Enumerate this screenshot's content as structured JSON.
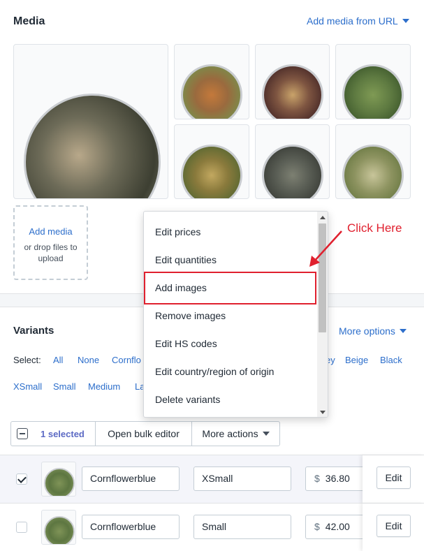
{
  "media": {
    "title": "Media",
    "add_from_url_label": "Add media from URL",
    "dropzone": {
      "add_label": "Add media",
      "hint": "or drop files to upload"
    },
    "images": [
      {
        "name": "herb-tea-large",
        "color": "#6d6b58"
      },
      {
        "name": "red-herb-tea",
        "color": "#9a6a3e"
      },
      {
        "name": "fruit-tea",
        "color": "#7e5541"
      },
      {
        "name": "green-tea",
        "color": "#5e7a41"
      },
      {
        "name": "genmaicha",
        "color": "#8a7a3c"
      },
      {
        "name": "gunpowder-tea",
        "color": "#5a5e55"
      },
      {
        "name": "lemongrass-tea",
        "color": "#8d9360"
      }
    ]
  },
  "variants": {
    "title": "Variants",
    "more_options_label": "More options",
    "select_label": "Select:",
    "select_links": [
      "All",
      "None",
      "Cornflo",
      "ey",
      "Beige",
      "Black"
    ],
    "size_links": [
      "XSmall",
      "Small",
      "Medium",
      "La"
    ],
    "bulk": {
      "selected_label": "1 selected",
      "open_editor_label": "Open bulk editor",
      "more_actions_label": "More actions"
    },
    "rows": [
      {
        "color": "Cornflowerblue",
        "size": "XSmall",
        "currency": "$",
        "price": "36.80",
        "edit_label": "Edit",
        "checked": true
      },
      {
        "color": "Cornflowerblue",
        "size": "Small",
        "currency": "$",
        "price": "42.00",
        "edit_label": "Edit",
        "checked": false
      }
    ]
  },
  "dropdown": {
    "items": [
      "Edit prices",
      "Edit quantities",
      "Add images",
      "Remove images",
      "Edit HS codes",
      "Edit country/region of origin",
      "Delete variants"
    ],
    "highlighted_item": "Add images"
  },
  "annotation": {
    "callout_text": "Click Here",
    "color": "#e0202e"
  },
  "colors": {
    "link": "#2c6ecb",
    "selected_count": "#5c6ac4",
    "selected_row_bg": "#f4f5fa"
  }
}
